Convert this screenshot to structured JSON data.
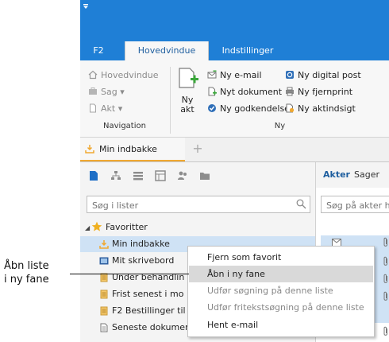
{
  "callout": {
    "text_line1": "Åbn liste",
    "text_line2": "i ny fane"
  },
  "quick_access": {
    "icon": "dropdown-arrow-icon"
  },
  "ribbon_tabs": [
    {
      "label": "F2"
    },
    {
      "label": "Hovedvindue"
    },
    {
      "label": "Indstillinger"
    }
  ],
  "ribbon": {
    "navigation": {
      "group_label": "Navigation",
      "items": [
        {
          "label": "Hovedvindue"
        },
        {
          "label": "Sag ▾"
        },
        {
          "label": "Akt ▾"
        }
      ]
    },
    "ny": {
      "group_label": "Ny",
      "big_button_line1": "Ny",
      "big_button_line2": "akt",
      "items": [
        {
          "label": "Ny e-mail"
        },
        {
          "label": "Nyt dokument"
        },
        {
          "label": "Ny godkendelse"
        },
        {
          "label": "Ny digital post"
        },
        {
          "label": "Ny fjernprint"
        },
        {
          "label": "Ny aktindsigt"
        }
      ]
    }
  },
  "doc_tabs": {
    "active": "Min indbakke",
    "add_symbol": "+"
  },
  "left_pane": {
    "search_placeholder": "Søg i lister",
    "tree": {
      "favorites_label": "Favoritter",
      "items": [
        {
          "label": "Min indbakke"
        },
        {
          "label": "Mit skrivebord"
        },
        {
          "label": "Under behandlin"
        },
        {
          "label": "Frist senest i mo"
        },
        {
          "label": "F2 Bestillinger til"
        },
        {
          "label": "Seneste dokumen"
        }
      ]
    }
  },
  "right_pane": {
    "tab_active": "Akter",
    "tab_other": "Sager",
    "search_placeholder": "Søg på akter h"
  },
  "context_menu": {
    "items": [
      {
        "label": "Fjern som favorit"
      },
      {
        "label": "Åbn i ny fane"
      },
      {
        "label": "Udfør søgning på denne liste"
      },
      {
        "label": "Udfør fritekstsøgning på denne liste"
      },
      {
        "label": "Hent e-mail"
      }
    ]
  },
  "colors": {
    "titlebar": "#1f7fd6",
    "accent_orange": "#f0a830",
    "selection": "#cfe2f5",
    "menu_highlight": "#d9d9d9"
  }
}
